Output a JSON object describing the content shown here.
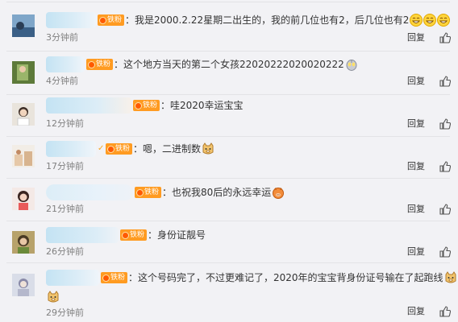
{
  "comments": [
    {
      "text": "：我是2000.2.22星期二出生的，我的前几位也有2，后几位也有2",
      "time": "3分钟前",
      "reply": "回复",
      "badge": "铁粉",
      "emoji": [
        "grin-emoji",
        "grin-emoji",
        "grin-emoji"
      ]
    },
    {
      "text": "：这个地方当天的第二个女孩22020222020020222",
      "time": "4分钟前",
      "reply": "回复",
      "badge": "铁粉",
      "emoji": [
        "ultraman-emoji"
      ]
    },
    {
      "text": "：哇2020幸运宝宝",
      "time": "12分钟前",
      "reply": "回复",
      "badge": "铁粉",
      "emoji": []
    },
    {
      "text": "：嗯，二进制数",
      "time": "17分钟前",
      "reply": "回复",
      "badge": "铁粉",
      "emoji": [
        "doge-emoji"
      ]
    },
    {
      "text": "：也祝我80后的永远幸运",
      "time": "21分钟前",
      "reply": "回复",
      "badge": "铁粉",
      "emoji": [
        "pig-emoji"
      ]
    },
    {
      "text": "：身份证靓号",
      "time": "26分钟前",
      "reply": "回复",
      "badge": "铁粉",
      "emoji": []
    },
    {
      "text": "：这个号码完了，不过更难记了，2020年的宝宝背身份证号输在了起跑线",
      "time": "29分钟前",
      "reply": "回复",
      "badge": "铁粉",
      "emoji": [
        "doge-emoji",
        "doge-emoji"
      ]
    }
  ],
  "colors": {
    "background": "#f2f2f5",
    "badge": "#ff9b21",
    "time": "#808080",
    "username_blur": "#c4e3f3"
  }
}
